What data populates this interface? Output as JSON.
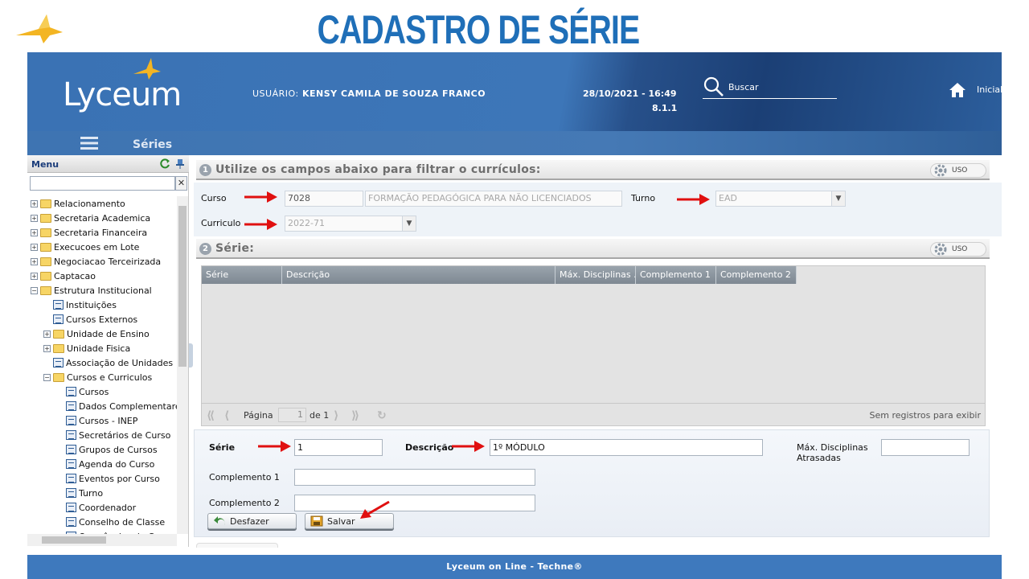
{
  "slide_title": "CADASTRO DE SÉRIE",
  "header": {
    "logo": "Lyceum",
    "user_prefix": "USUÁRIO:",
    "user_name": "KENSY CAMILA DE SOUZA FRANCO",
    "datetime": "28/10/2021 - 16:49",
    "version": "8.1.1",
    "search_label": "Buscar",
    "home_label": "Inicial"
  },
  "subbar": {
    "title": "Séries"
  },
  "menu": {
    "title": "Menu",
    "clear": "✕",
    "items": [
      {
        "label": "Relacionamento",
        "type": "folder",
        "level": 0,
        "toggle": "+"
      },
      {
        "label": "Secretaria Academica",
        "type": "folder",
        "level": 0,
        "toggle": "+"
      },
      {
        "label": "Secretaria Financeira",
        "type": "folder",
        "level": 0,
        "toggle": "+"
      },
      {
        "label": "Execucoes em Lote",
        "type": "folder",
        "level": 0,
        "toggle": "+"
      },
      {
        "label": "Negociacao Terceirizada",
        "type": "folder",
        "level": 0,
        "toggle": "+"
      },
      {
        "label": "Captacao",
        "type": "folder",
        "level": 0,
        "toggle": "+"
      },
      {
        "label": "Estrutura Institucional",
        "type": "folder",
        "level": 0,
        "toggle": "−"
      },
      {
        "label": "Instituições",
        "type": "doc",
        "level": 1
      },
      {
        "label": "Cursos Externos",
        "type": "doc",
        "level": 1
      },
      {
        "label": "Unidade de Ensino",
        "type": "folder",
        "level": 1,
        "toggle": "+"
      },
      {
        "label": "Unidade Fisica",
        "type": "folder",
        "level": 1,
        "toggle": "+"
      },
      {
        "label": "Associação de Unidades",
        "type": "doc",
        "level": 1
      },
      {
        "label": "Cursos e Curriculos",
        "type": "folder",
        "level": 1,
        "toggle": "−"
      },
      {
        "label": "Cursos",
        "type": "doc",
        "level": 2
      },
      {
        "label": "Dados Complementares",
        "type": "doc",
        "level": 2
      },
      {
        "label": "Cursos - INEP",
        "type": "doc",
        "level": 2
      },
      {
        "label": "Secretários de Curso",
        "type": "doc",
        "level": 2
      },
      {
        "label": "Grupos de Cursos",
        "type": "doc",
        "level": 2
      },
      {
        "label": "Agenda do Curso",
        "type": "doc",
        "level": 2
      },
      {
        "label": "Eventos por Curso",
        "type": "doc",
        "level": 2
      },
      {
        "label": "Turno",
        "type": "doc",
        "level": 2
      },
      {
        "label": "Coordenador",
        "type": "doc",
        "level": 2
      },
      {
        "label": "Conselho de Classe",
        "type": "doc",
        "level": 2
      },
      {
        "label": "Ocorrências de Curso",
        "type": "doc",
        "level": 2
      }
    ]
  },
  "filter_panel": {
    "number": "1",
    "title": "Utilize os campos abaixo para filtrar o currículos:",
    "uso": "USO",
    "curso_label": "Curso",
    "curso_code": "7028",
    "curso_name": "FORMAÇÃO PEDAGÓGICA PARA NÃO LICENCIADOS",
    "turno_label": "Turno",
    "turno_value": "EAD",
    "curriculo_label": "Curriculo",
    "curriculo_value": "2022-71"
  },
  "serie_panel": {
    "number": "2",
    "title": "Série:",
    "uso": "USO",
    "columns": [
      "Série",
      "Descrição",
      "Máx. Disciplinas ...",
      "Complemento 1",
      "Complemento 2"
    ],
    "pager": {
      "page_label": "Página",
      "page_value": "1",
      "of_label": "de 1",
      "empty": "Sem registros para exibir"
    }
  },
  "form": {
    "serie_label": "Série",
    "serie_value": "1",
    "descricao_label": "Descrição",
    "descricao_value": "1º MÓDULO",
    "max_label_1": "Máx. Disciplinas",
    "max_label_2": "Atrasadas",
    "max_value": "",
    "comp1_label": "Complemento 1",
    "comp1_value": "",
    "comp2_label": "Complemento 2",
    "comp2_value": "",
    "undo_label": "Desfazer",
    "save_label": "Salvar"
  },
  "footer": {
    "text": "Lyceum on Line - Techne®"
  },
  "colors": {
    "brand_blue": "#3e79bd",
    "title_blue": "#1f6fb8",
    "annotation_red": "#e01010",
    "bird_gold": "#f3b523"
  }
}
